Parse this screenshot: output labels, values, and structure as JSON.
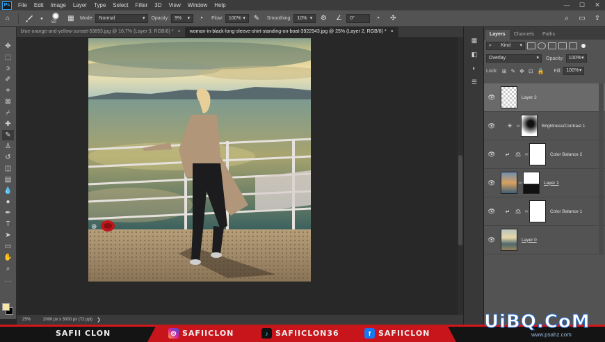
{
  "app": {
    "logo": "Ps"
  },
  "menu": [
    "File",
    "Edit",
    "Image",
    "Layer",
    "Type",
    "Select",
    "Filter",
    "3D",
    "View",
    "Window",
    "Help"
  ],
  "window_controls": [
    "—",
    "☐",
    "✕"
  ],
  "options": {
    "brush_size": "50",
    "mode_label": "Mode:",
    "mode_value": "Normal",
    "opacity_label": "Opacity:",
    "opacity_value": "9%",
    "flow_label": "Flow:",
    "flow_value": "100%",
    "smoothing_label": "Smoothing:",
    "smoothing_value": "10%",
    "angle_value": "0°"
  },
  "tabs": [
    {
      "label": "blue-orange-and-yellow-sunset-53893.jpg @ 16,7% (Layer 3, RGB/8) *",
      "close": "×"
    },
    {
      "label": "woman-in-black-long-sleeve-shirt-standing-on-boat-3922943.jpg @ 25% (Layer 2, RGB/8) *",
      "close": "×"
    }
  ],
  "status": {
    "zoom": "25%",
    "doc_info": "2000 px x 3000 px (72 ppi)",
    "arrow": "❯"
  },
  "colors": {
    "foreground": "#f6e7a8",
    "background": "#000000",
    "accent": "#d4161c"
  },
  "panel": {
    "tabs": [
      "Layers",
      "Channels",
      "Paths"
    ],
    "filter_kind": "Kind",
    "blend_mode": "Overlay",
    "opacity_label": "Opacity:",
    "opacity_value": "100%",
    "lock_label": "Lock:",
    "fill_label": "Fill:",
    "fill_value": "100%",
    "layers": [
      {
        "name": "Layer 2"
      },
      {
        "name": "Brightness/Contrast 1"
      },
      {
        "name": "Color Balance 2"
      },
      {
        "name": "Layer 1"
      },
      {
        "name": "Color Balance 1"
      },
      {
        "name": "Layer 0"
      }
    ]
  },
  "banner": {
    "left": "SAFII CLON",
    "instagram": "SAFIICLON",
    "tiktok": "SAFIICLON36",
    "facebook": "SAFIICLON"
  },
  "watermark": {
    "text": "UiBQ.CoM",
    "sub": "www.psahz.com"
  }
}
